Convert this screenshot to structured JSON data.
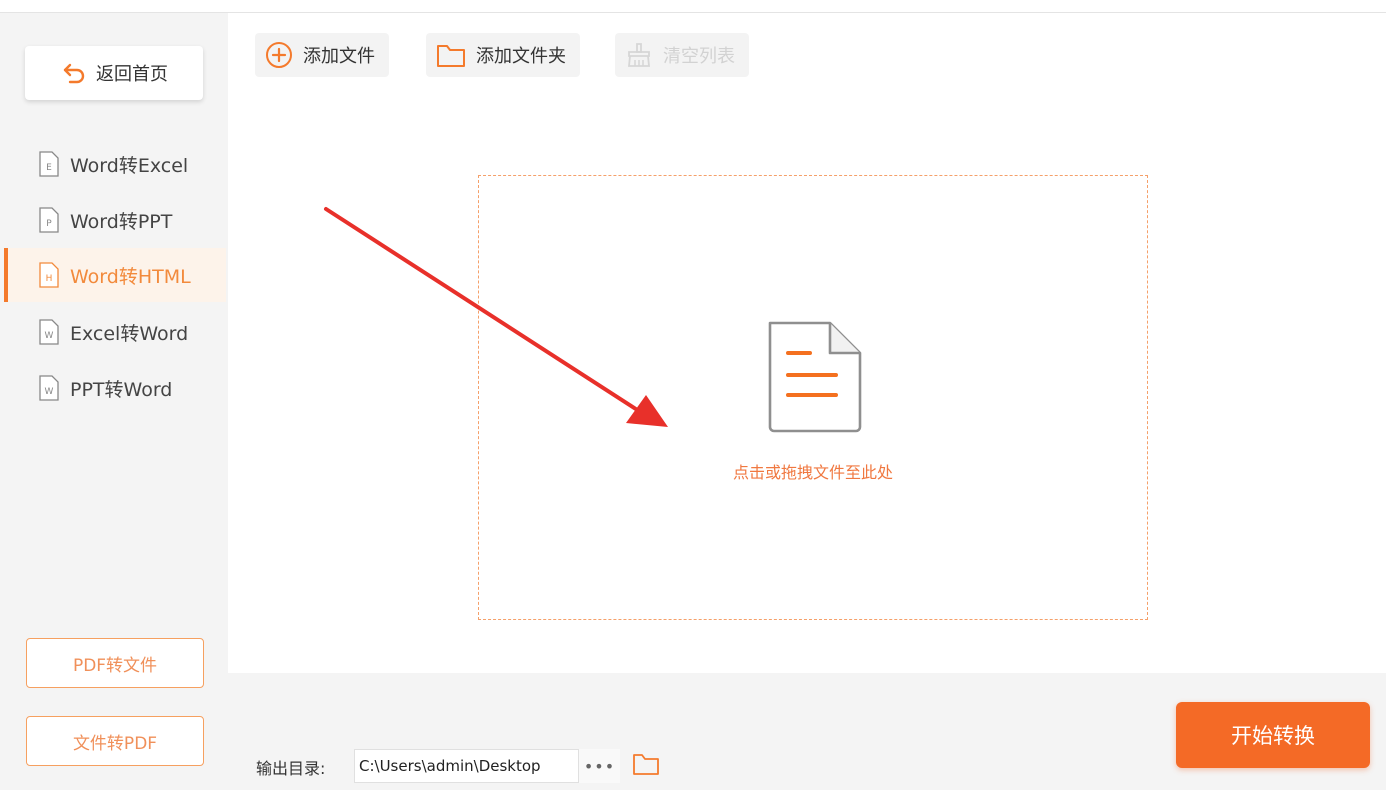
{
  "sidebar": {
    "back_label": "返回首页",
    "items": [
      {
        "label": "Word转Excel",
        "icon": "excel-file-icon",
        "badge": "E",
        "active": false
      },
      {
        "label": "Word转PPT",
        "icon": "ppt-file-icon",
        "badge": "P",
        "active": false
      },
      {
        "label": "Word转HTML",
        "icon": "html-file-icon",
        "badge": "H",
        "active": true
      },
      {
        "label": "Excel转Word",
        "icon": "word-file-icon",
        "badge": "W",
        "active": false
      },
      {
        "label": "PPT转Word",
        "icon": "word-file-icon",
        "badge": "W",
        "active": false
      }
    ],
    "pdf_to_file_label": "PDF转文件",
    "file_to_pdf_label": "文件转PDF"
  },
  "toolbar": {
    "add_file_label": "添加文件",
    "add_folder_label": "添加文件夹",
    "clear_list_label": "清空列表"
  },
  "dropzone": {
    "hint": "点击或拖拽文件至此处"
  },
  "footer": {
    "output_label": "输出目录:",
    "output_path": "C:\\Users\\admin\\Desktop",
    "more_label": "•••",
    "start_label": "开始转换"
  },
  "colors": {
    "accent": "#f46a26",
    "accent_light": "#f5a06a",
    "active_bg": "#fdf3ea",
    "annotation_arrow": "#e8302a"
  }
}
